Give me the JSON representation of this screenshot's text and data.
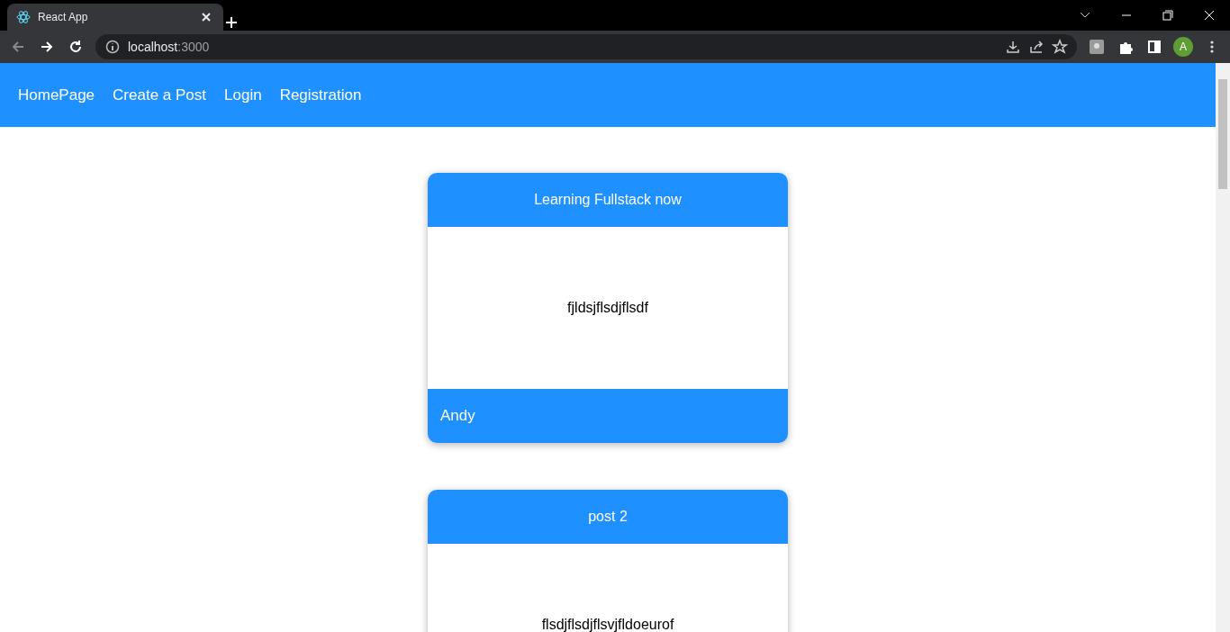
{
  "browser": {
    "tab_title": "React App",
    "url_host": "localhost",
    "url_port": ":3000",
    "profile_initial": "A"
  },
  "navbar": {
    "links": [
      "HomePage",
      "Create a Post",
      "Login",
      "Registration"
    ]
  },
  "posts": [
    {
      "title": "Learning Fullstack now",
      "body": "fjldsjflsdjflsdf",
      "username": "Andy"
    },
    {
      "title": "post 2",
      "body": "flsdjflsdjflsvjfldoeurof"
    }
  ]
}
